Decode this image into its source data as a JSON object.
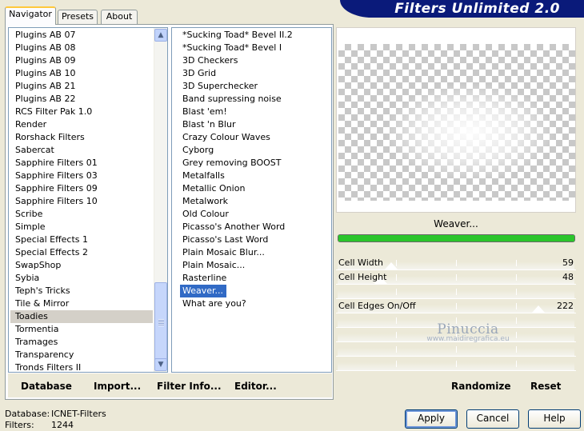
{
  "app": {
    "title": "Filters Unlimited 2.0"
  },
  "tabs": [
    {
      "label": "Navigator"
    },
    {
      "label": "Presets"
    },
    {
      "label": "About"
    }
  ],
  "categories": [
    "Plugins AB 07",
    "Plugins AB 08",
    "Plugins AB 09",
    "Plugins AB 10",
    "Plugins AB 21",
    "Plugins AB 22",
    "RCS Filter Pak 1.0",
    "Render",
    "Rorshack Filters",
    "Sabercat",
    "Sapphire Filters 01",
    "Sapphire Filters 03",
    "Sapphire Filters 09",
    "Sapphire Filters 10",
    "Scribe",
    "Simple",
    "Special Effects 1",
    "Special Effects 2",
    "SwapShop",
    "Sybia",
    "Teph's Tricks",
    "Tile & Mirror",
    "Toadies",
    "Tormentia",
    "Tramages",
    "Transparency",
    "Tronds Filters II"
  ],
  "selected_category": "Toadies",
  "filters": [
    "*Sucking Toad*  Bevel II.2",
    "*Sucking Toad*  Bevel I",
    "3D Checkers",
    "3D Grid",
    "3D Superchecker",
    "Band supressing noise",
    "Blast 'em!",
    "Blast 'n Blur",
    "Crazy Colour Waves",
    "Cyborg",
    "Grey removing BOOST",
    "Metalfalls",
    "Metallic Onion",
    "Metalwork",
    "Old Colour",
    "Picasso's Another Word",
    "Picasso's Last Word",
    "Plain Mosaic Blur...",
    "Plain Mosaic...",
    "Rasterline",
    "Weaver...",
    "What are you?"
  ],
  "selected_filter": "Weaver...",
  "left_buttons": {
    "database": "Database",
    "import": "Import...",
    "filter_info": "Filter Info...",
    "editor": "Editor..."
  },
  "preview": {
    "filter_name": "Weaver...",
    "progress": 1.0
  },
  "params": [
    {
      "label": "Cell Width",
      "value": "59",
      "max": 255
    },
    {
      "label": "Cell Height",
      "value": "48",
      "max": 255
    },
    {
      "label": "",
      "value": ""
    },
    {
      "label": "Cell Edges On/Off",
      "value": "222",
      "max": 255
    },
    {
      "label": "",
      "value": ""
    },
    {
      "label": "",
      "value": ""
    },
    {
      "label": "",
      "value": ""
    },
    {
      "label": "",
      "value": ""
    }
  ],
  "watermark": {
    "name": "Pinuccia",
    "url": "www.maidiregrafica.eu"
  },
  "right_buttons": {
    "randomize": "Randomize",
    "reset": "Reset"
  },
  "info": {
    "database_label": "Database:",
    "database_value": "ICNET-Filters",
    "filters_label": "Filters:",
    "filters_value": "1244"
  },
  "dialog_buttons": {
    "apply": "Apply",
    "cancel": "Cancel",
    "help": "Help"
  }
}
